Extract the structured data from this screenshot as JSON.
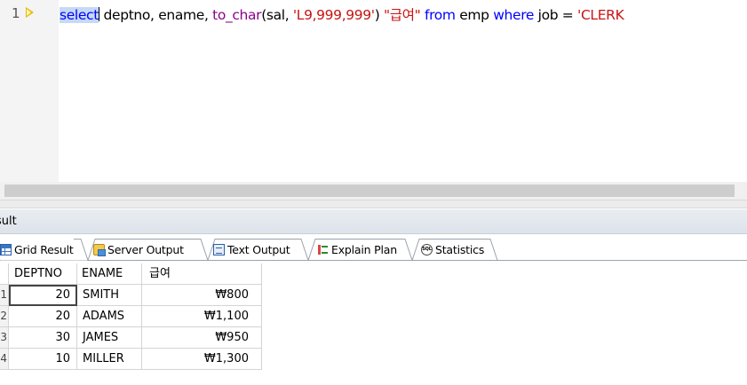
{
  "editor": {
    "line_number": "1",
    "sql": [
      {
        "text": "select",
        "cls": "kw-sel"
      },
      {
        "text": " deptno, ename, ",
        "cls": "plain"
      },
      {
        "text": "to_char",
        "cls": "func"
      },
      {
        "text": "(sal, ",
        "cls": "plain"
      },
      {
        "text": "'L9,999,999'",
        "cls": "str"
      },
      {
        "text": ") ",
        "cls": "plain"
      },
      {
        "text": "\"급여\"",
        "cls": "str"
      },
      {
        "text": " ",
        "cls": "plain"
      },
      {
        "text": "from",
        "cls": "kw"
      },
      {
        "text": " emp ",
        "cls": "plain"
      },
      {
        "text": "where",
        "cls": "kw"
      },
      {
        "text": " job = ",
        "cls": "plain"
      },
      {
        "text": "'CLERK",
        "cls": "str"
      }
    ]
  },
  "result_panel": {
    "title": "sult"
  },
  "tabs": [
    {
      "label": "Grid Result",
      "icon": "grid-icon",
      "active": true
    },
    {
      "label": "Server Output",
      "icon": "server-output-icon",
      "active": false
    },
    {
      "label": "Text Output",
      "icon": "text-output-icon",
      "active": false
    },
    {
      "label": "Explain Plan",
      "icon": "explain-plan-icon",
      "active": false
    },
    {
      "label": "Statistics",
      "icon": "statistics-icon",
      "active": false
    }
  ],
  "grid": {
    "columns": [
      "DEPTNO",
      "ENAME",
      "급여"
    ],
    "rows": [
      {
        "num": "1",
        "deptno": "20",
        "ename": "SMITH",
        "sal": "₩800"
      },
      {
        "num": "2",
        "deptno": "20",
        "ename": "ADAMS",
        "sal": "₩1,100"
      },
      {
        "num": "3",
        "deptno": "30",
        "ename": "JAMES",
        "sal": "₩950"
      },
      {
        "num": "4",
        "deptno": "10",
        "ename": "MILLER",
        "sal": "₩1,300"
      }
    ]
  }
}
